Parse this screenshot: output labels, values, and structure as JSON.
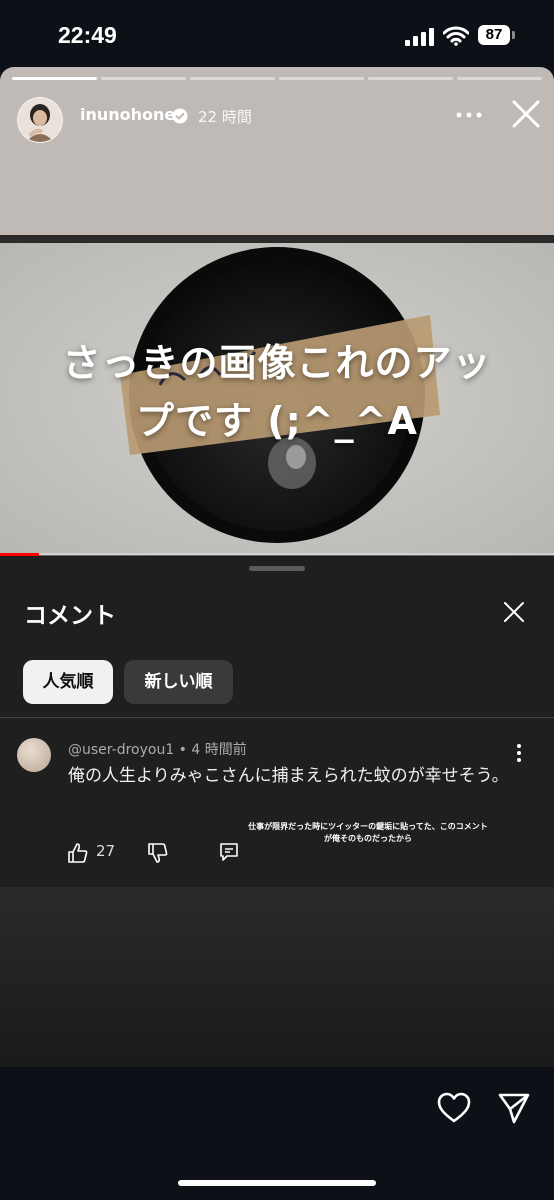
{
  "status_bar": {
    "time": "22:49",
    "battery": "87"
  },
  "story": {
    "username": "inunohone",
    "time_ago": "22 時間",
    "progress_segments": 6,
    "active_segment": 0
  },
  "video": {
    "caption_line1": "さっきの画像これのアッ",
    "caption_line2": "プです (;^_^A",
    "progress": 0.07
  },
  "comments": {
    "title": "コメント",
    "chips": [
      {
        "label": "人気順",
        "selected": true
      },
      {
        "label": "新しい順",
        "selected": false
      }
    ],
    "items": [
      {
        "author": "@user-droyou1 • 4 時間前",
        "text": "俺の人生よりみゃこさんに捕まえられた蚊のが幸せそう。",
        "likes": "27"
      }
    ],
    "overlay_line1": "仕事が限界だった時にツイッターの鍵垢に貼ってた、このコメント",
    "overlay_line2": "が俺そのものだったから"
  },
  "colors": {
    "accent_red": "#ff0000",
    "panel_bg": "#1f1f1f"
  }
}
